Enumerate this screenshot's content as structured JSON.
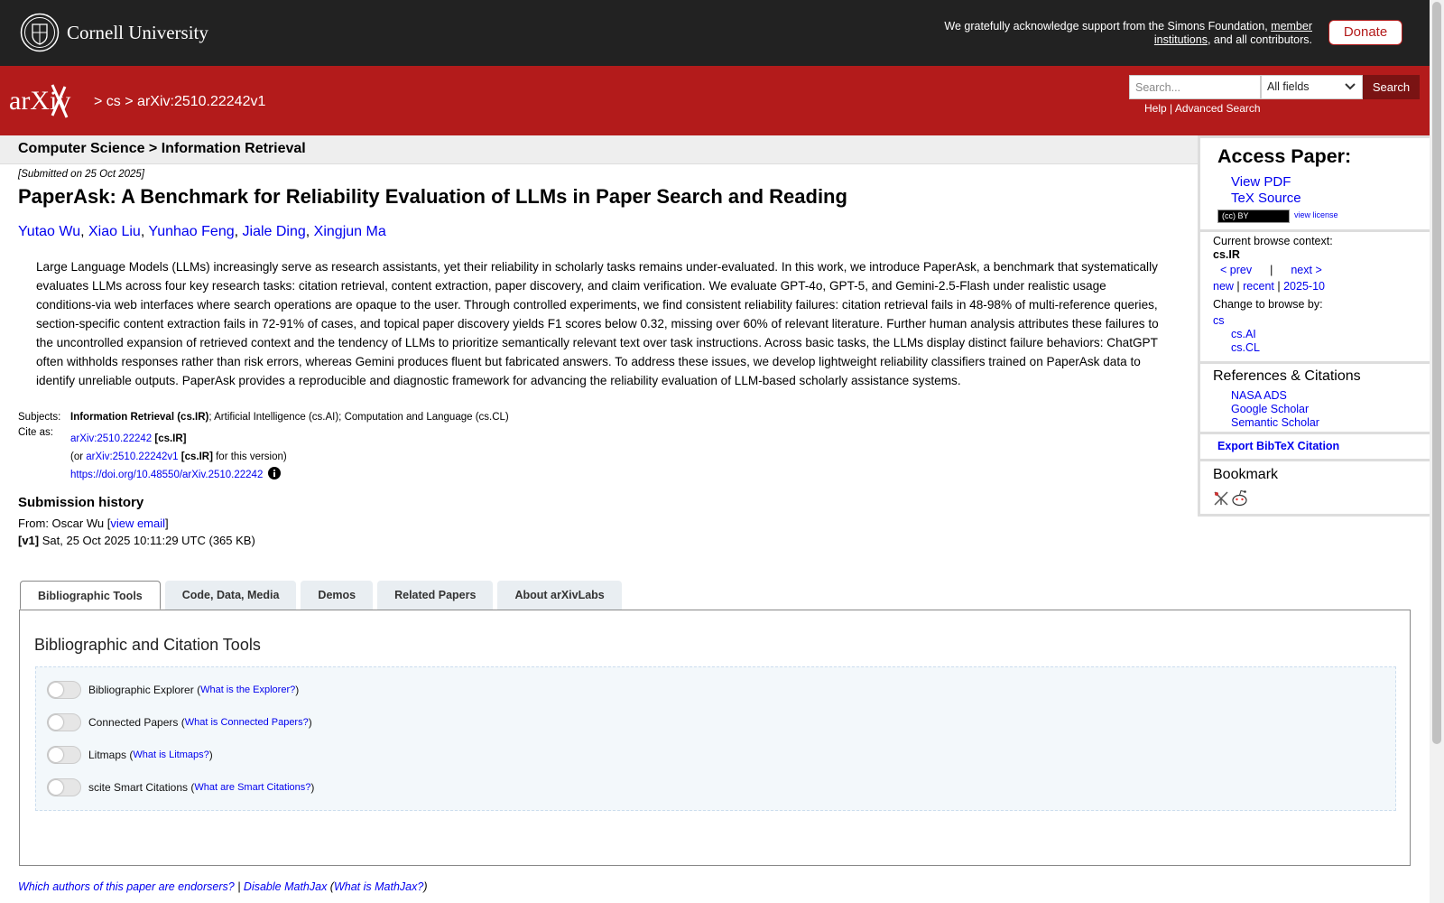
{
  "cornell": {
    "name": "Cornell University",
    "support_prefix": "We gratefully acknowledge support from the Simons Foundation, ",
    "support_link": "member institutions",
    "support_suffix": ", and all contributors.",
    "donate_label": "Donate"
  },
  "header": {
    "logo_text": "arXiv",
    "breadcrumb_sep1": ">",
    "breadcrumb_cs": "cs",
    "breadcrumb_sep2": ">",
    "breadcrumb_id": "arXiv:2510.22242v1",
    "search_placeholder": "Search...",
    "field_selected": "All fields",
    "search_button": "Search",
    "help_link": "Help",
    "help_sep": "|",
    "advanced_link": "Advanced Search"
  },
  "paper": {
    "subject_line": "Computer Science > Information Retrieval",
    "submitted": "[Submitted on 25 Oct 2025]",
    "title": "PaperAsk: A Benchmark for Reliability Evaluation of LLMs in Paper Search and Reading",
    "authors": [
      "Yutao Wu",
      "Xiao Liu",
      "Yunhao Feng",
      "Jiale Ding",
      "Xingjun Ma"
    ],
    "author_sep": ", ",
    "abstract": "Large Language Models (LLMs) increasingly serve as research assistants, yet their reliability in scholarly tasks remains under-evaluated. In this work, we introduce PaperAsk, a benchmark that systematically evaluates LLMs across four key research tasks: citation retrieval, content extraction, paper discovery, and claim verification. We evaluate GPT-4o, GPT-5, and Gemini-2.5-Flash under realistic usage conditions-via web interfaces where search operations are opaque to the user. Through controlled experiments, we find consistent reliability failures: citation retrieval fails in 48-98% of multi-reference queries, section-specific content extraction fails in 72-91% of cases, and topical paper discovery yields F1 scores below 0.32, missing over 60% of relevant literature. Further human analysis attributes these failures to the uncontrolled expansion of retrieved context and the tendency of LLMs to prioritize semantically relevant text over task instructions. Across basic tasks, the LLMs display distinct failure behaviors: ChatGPT often withholds responses rather than risk errors, whereas Gemini produces fluent but fabricated answers. To address these issues, we develop lightweight reliability classifiers trained on PaperAsk data to identify unreliable outputs. PaperAsk provides a reproducible and diagnostic framework for advancing the reliability evaluation of LLM-based scholarly assistance systems.",
    "subjects_label": "Subjects:",
    "subjects_primary": "Information Retrieval (cs.IR)",
    "subjects_rest": "; Artificial Intelligence (cs.AI); Computation and Language (cs.CL)",
    "cite_label": "Cite as:",
    "cite_id": "arXiv:2510.22242",
    "cite_cat": "[cs.IR]",
    "cite_or_prefix": "(or ",
    "cite_version_id": "arXiv:2510.22242v1",
    "cite_version_cat": "[cs.IR]",
    "cite_version_suffix": " for this version)",
    "doi": "https://doi.org/10.48550/arXiv.2510.22242",
    "history_title": "Submission history",
    "history_from_prefix": "From: Oscar Wu [",
    "history_view_email": "view email",
    "history_from_suffix": "]",
    "history_v1_label": "[v1]",
    "history_v1_text": " Sat, 25 Oct 2025 10:11:29 UTC (365 KB)"
  },
  "tabs": [
    {
      "label": "Bibliographic Tools",
      "active": true
    },
    {
      "label": "Code, Data, Media"
    },
    {
      "label": "Demos"
    },
    {
      "label": "Related Papers"
    },
    {
      "label": "About arXivLabs"
    }
  ],
  "panel": {
    "title": "Bibliographic and Citation Tools",
    "toggles": [
      {
        "label": "Bibliographic Explorer",
        "link": "What is the Explorer?"
      },
      {
        "label": "Connected Papers",
        "link": "What is Connected Papers?"
      },
      {
        "label": "Litmaps",
        "link": "What is Litmaps?"
      },
      {
        "label": "scite Smart Citations",
        "link": "What are Smart Citations?"
      }
    ]
  },
  "footer": {
    "endorsers": "Which authors of this paper are endorsers?",
    "sep": " | ",
    "disable_mathjax": "Disable MathJax",
    "what_mathjax": "What is MathJax?"
  },
  "sidebar": {
    "access_title": "Access Paper:",
    "view_pdf": "View PDF",
    "tex_source": "TeX Source",
    "license_badge": "(cc) BY",
    "view_license": "view license",
    "browse_context_label": "Current browse context:",
    "browse_context": "cs.IR",
    "prev": "< prev",
    "nav_sep": "|",
    "next": "next >",
    "new": "new",
    "recent": "recent",
    "month": "2025-10",
    "change_browse": "Change to browse by:",
    "browse_cs": "cs",
    "browse_ai": "cs.AI",
    "browse_cl": "cs.CL",
    "refs_title": "References & Citations",
    "nasa": "NASA ADS",
    "google": "Google Scholar",
    "semantic": "Semantic Scholar",
    "export_bibtex": "Export BibTeX Citation",
    "bookmark_title": "Bookmark"
  },
  "colors": {
    "arxiv_red": "#b31b1b",
    "cornell_black": "#222222",
    "link_blue": "#0000ee"
  }
}
